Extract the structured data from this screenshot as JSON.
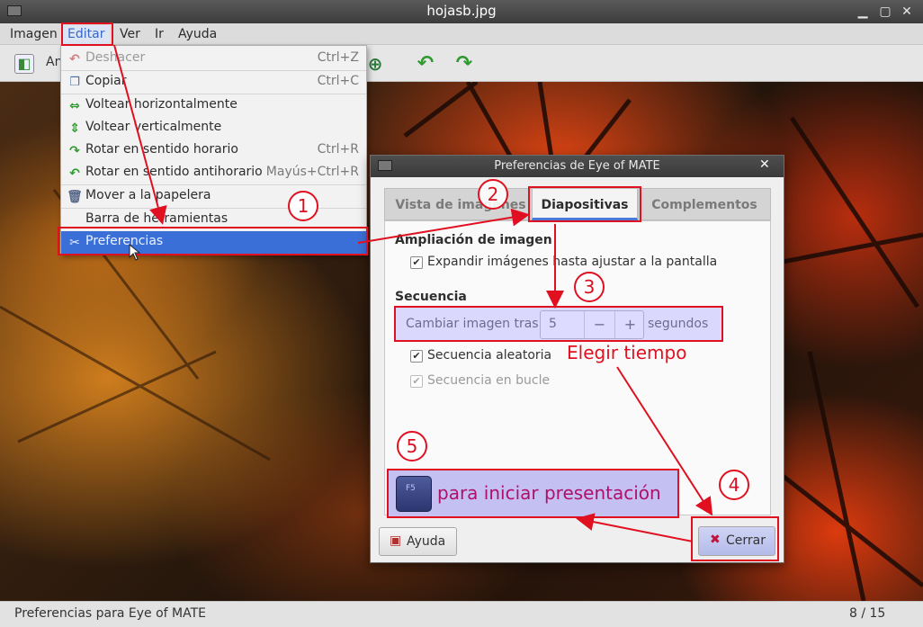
{
  "window": {
    "title": "hojasb.jpg"
  },
  "menubar": {
    "items": [
      "Imagen",
      "Editar",
      "Ver",
      "Ir",
      "Ayuda"
    ]
  },
  "toolbar": {
    "partial_label": "An"
  },
  "edit_menu": {
    "items": [
      {
        "label": "Deshacer",
        "accel": "Ctrl+Z",
        "icon": "undo-icon",
        "disabled": true
      },
      {
        "label": "Copiar",
        "accel": "Ctrl+C",
        "icon": "copy-icon"
      },
      {
        "label": "Voltear horizontalmente",
        "accel": "",
        "icon": "flip-horizontal-icon"
      },
      {
        "label": "Voltear verticalmente",
        "accel": "",
        "icon": "flip-vertical-icon"
      },
      {
        "label": "Rotar en sentido horario",
        "accel": "Ctrl+R",
        "icon": "rotate-clockwise-icon"
      },
      {
        "label": "Rotar en sentido antihorario",
        "accel": "Mayús+Ctrl+R",
        "icon": "rotate-counterclockwise-icon"
      },
      {
        "label": "Mover a la papelera",
        "accel": "",
        "icon": "trash-icon"
      },
      {
        "label": "Barra de herramientas",
        "accel": ""
      },
      {
        "label": "Preferencias",
        "accel": "",
        "icon": "preferences-icon",
        "selected": true
      }
    ]
  },
  "dialog": {
    "title": "Preferencias de Eye of MATE",
    "tabs": [
      "Vista de imágenes",
      "Diapositivas",
      "Complementos"
    ],
    "active_tab": "Diapositivas",
    "zoom_section": "Ampliación de imagen",
    "expand_label": "Expandir imágenes hasta ajustar a la pantalla",
    "sequence_section": "Secuencia",
    "change_label": "Cambiar imagen tras:",
    "change_value": "5",
    "minus": "−",
    "plus": "+",
    "seconds": "segundos",
    "random_label": "Secuencia aleatoria",
    "loop_label": "Secuencia en bucle",
    "help_button": "Ayuda",
    "close_button": "Cerrar"
  },
  "annotations": {
    "numbers": [
      "1",
      "2",
      "3",
      "4",
      "5"
    ],
    "choose_time": "Elegir tiempo",
    "f5_key": "F5",
    "start_presentation": "para iniciar presentación",
    "color": "#e01020"
  },
  "statusbar": {
    "text": "Preferencias para Eye of MATE",
    "position": "8 / 15"
  }
}
